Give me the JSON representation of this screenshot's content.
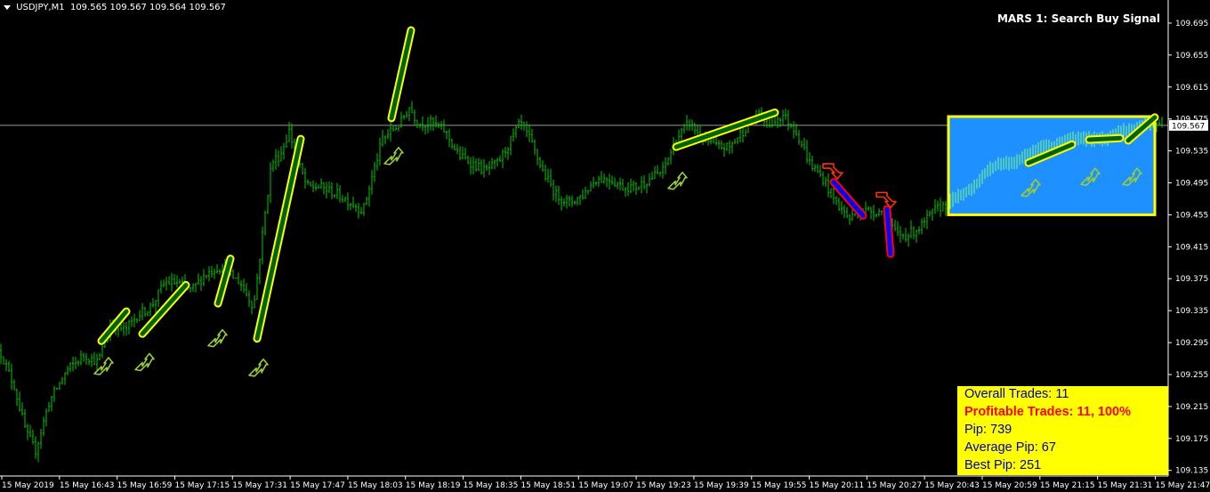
{
  "header": {
    "symbol": "USDJPY,M1",
    "ohlc": "109.565 109.567 109.564 109.567"
  },
  "signal": "MARS 1: Search Buy Signal",
  "current_price": "109.567",
  "colors": {
    "background": "#000000",
    "candle": "#00c800",
    "trend_up_fill": "#006400",
    "trend_up_border": "#ffff00",
    "trend_down_fill": "#0000ff",
    "trend_down_border": "#ff0000",
    "zone_fill": "#1e90ff",
    "zone_border": "#ffff00",
    "buy_arrow": "#9acd32",
    "sell_arrow": "#ff3300",
    "axis": "#ffffff",
    "stats_bg": "#ffff00",
    "stats_text": "#0000aa",
    "stats_highlight": "#ff0000"
  },
  "stats": {
    "overall": "Overall Trades: 11",
    "profitable": "Profitable Trades: 11, 100%",
    "pip": "Pip: 739",
    "average_pip": "Average Pip: 67",
    "best_pip": "Best Pip: 251"
  },
  "chart_data": {
    "type": "candlestick",
    "symbol": "USDJPY",
    "timeframe": "M1",
    "y_axis_labels": [
      "109.695",
      "109.655",
      "109.615",
      "109.575",
      "109.535",
      "109.495",
      "109.455",
      "109.415",
      "109.375",
      "109.335",
      "109.295",
      "109.255",
      "109.215",
      "109.175",
      "109.135"
    ],
    "y_range": [
      109.128,
      109.715
    ],
    "x_axis_labels": [
      "15 May 2019",
      "15 May 16:43",
      "15 May 16:59",
      "15 May 17:15",
      "15 May 17:31",
      "15 May 17:47",
      "15 May 18:03",
      "15 May 18:19",
      "15 May 18:35",
      "15 May 18:51",
      "15 May 19:07",
      "15 May 19:23",
      "15 May 19:39",
      "15 May 19:55",
      "15 May 20:11",
      "15 May 20:27",
      "15 May 20:43",
      "15 May 20:59",
      "15 May 21:15",
      "15 May 21:31",
      "15 May 21:47"
    ],
    "price_path": [
      [
        0,
        109.285
      ],
      [
        16,
        109.24
      ],
      [
        30,
        109.18
      ],
      [
        40,
        109.16
      ],
      [
        55,
        109.22
      ],
      [
        75,
        109.26
      ],
      [
        95,
        109.28
      ],
      [
        110,
        109.27
      ],
      [
        125,
        109.32
      ],
      [
        140,
        109.31
      ],
      [
        155,
        109.33
      ],
      [
        170,
        109.34
      ],
      [
        185,
        109.37
      ],
      [
        200,
        109.37
      ],
      [
        215,
        109.36
      ],
      [
        230,
        109.38
      ],
      [
        245,
        109.39
      ],
      [
        258,
        109.38
      ],
      [
        270,
        109.37
      ],
      [
        285,
        109.34
      ],
      [
        295,
        109.43
      ],
      [
        305,
        109.52
      ],
      [
        315,
        109.53
      ],
      [
        325,
        109.56
      ],
      [
        335,
        109.52
      ],
      [
        345,
        109.49
      ],
      [
        360,
        109.49
      ],
      [
        380,
        109.48
      ],
      [
        395,
        109.47
      ],
      [
        408,
        109.46
      ],
      [
        420,
        109.51
      ],
      [
        430,
        109.55
      ],
      [
        440,
        109.56
      ],
      [
        450,
        109.57
      ],
      [
        460,
        109.59
      ],
      [
        470,
        109.57
      ],
      [
        485,
        109.57
      ],
      [
        500,
        109.56
      ],
      [
        515,
        109.53
      ],
      [
        530,
        109.52
      ],
      [
        545,
        109.51
      ],
      [
        560,
        109.52
      ],
      [
        575,
        109.55
      ],
      [
        585,
        109.57
      ],
      [
        595,
        109.55
      ],
      [
        610,
        109.51
      ],
      [
        625,
        109.48
      ],
      [
        640,
        109.47
      ],
      [
        655,
        109.48
      ],
      [
        670,
        109.5
      ],
      [
        685,
        109.5
      ],
      [
        700,
        109.49
      ],
      [
        715,
        109.49
      ],
      [
        730,
        109.5
      ],
      [
        745,
        109.51
      ],
      [
        760,
        109.55
      ],
      [
        775,
        109.57
      ],
      [
        790,
        109.55
      ],
      [
        805,
        109.54
      ],
      [
        820,
        109.54
      ],
      [
        835,
        109.56
      ],
      [
        850,
        109.58
      ],
      [
        865,
        109.57
      ],
      [
        880,
        109.58
      ],
      [
        895,
        109.56
      ],
      [
        910,
        109.52
      ],
      [
        925,
        109.5
      ],
      [
        940,
        109.47
      ],
      [
        955,
        109.45
      ],
      [
        965,
        109.46
      ],
      [
        975,
        109.46
      ],
      [
        990,
        109.46
      ],
      [
        1000,
        109.44
      ],
      [
        1010,
        109.43
      ],
      [
        1020,
        109.43
      ],
      [
        1035,
        109.44
      ],
      [
        1050,
        109.46
      ],
      [
        1065,
        109.47
      ],
      [
        1080,
        109.48
      ],
      [
        1095,
        109.49
      ],
      [
        1110,
        109.51
      ],
      [
        1125,
        109.52
      ],
      [
        1140,
        109.52
      ],
      [
        1155,
        109.53
      ],
      [
        1170,
        109.54
      ],
      [
        1185,
        109.54
      ],
      [
        1200,
        109.55
      ],
      [
        1215,
        109.55
      ],
      [
        1230,
        109.55
      ],
      [
        1245,
        109.55
      ],
      [
        1260,
        109.56
      ],
      [
        1275,
        109.56
      ],
      [
        1290,
        109.57
      ],
      [
        1305,
        109.57
      ]
    ],
    "trend_segments_up": [
      [
        [
          114,
          109.297
        ],
        [
          142,
          109.334
        ]
      ],
      [
        [
          160,
          109.306
        ],
        [
          209,
          109.367
        ]
      ],
      [
        [
          245,
          109.344
        ],
        [
          259,
          109.4
        ]
      ],
      [
        [
          289,
          109.3
        ],
        [
          338,
          109.55
        ]
      ],
      [
        [
          440,
          109.576
        ],
        [
          462,
          109.686
        ]
      ],
      [
        [
          760,
          109.54
        ],
        [
          871,
          109.583
        ]
      ],
      [
        [
          1156,
          109.52
        ],
        [
          1205,
          109.543
        ]
      ],
      [
        [
          1224,
          109.549
        ],
        [
          1259,
          109.551
        ]
      ],
      [
        [
          1268,
          109.548
        ],
        [
          1298,
          109.577
        ]
      ]
    ],
    "trend_segments_down": [
      [
        [
          937,
          109.496
        ],
        [
          970,
          109.454
        ]
      ],
      [
        [
          997,
          109.462
        ],
        [
          1001,
          109.406
        ]
      ]
    ],
    "buy_arrows": [
      [
        116,
        109.265
      ],
      [
        162,
        109.27
      ],
      [
        244,
        109.3
      ],
      [
        290,
        109.263
      ],
      [
        442,
        109.528
      ],
      [
        761,
        109.497
      ],
      [
        1158,
        109.488
      ],
      [
        1225,
        109.502
      ],
      [
        1272,
        109.502
      ]
    ],
    "sell_arrows": [
      [
        935,
        109.51
      ],
      [
        995,
        109.474
      ]
    ],
    "zone": {
      "x_range": [
        1066,
        1298
      ],
      "y_range": [
        109.455,
        109.578
      ]
    },
    "current_price_value": 109.567
  }
}
